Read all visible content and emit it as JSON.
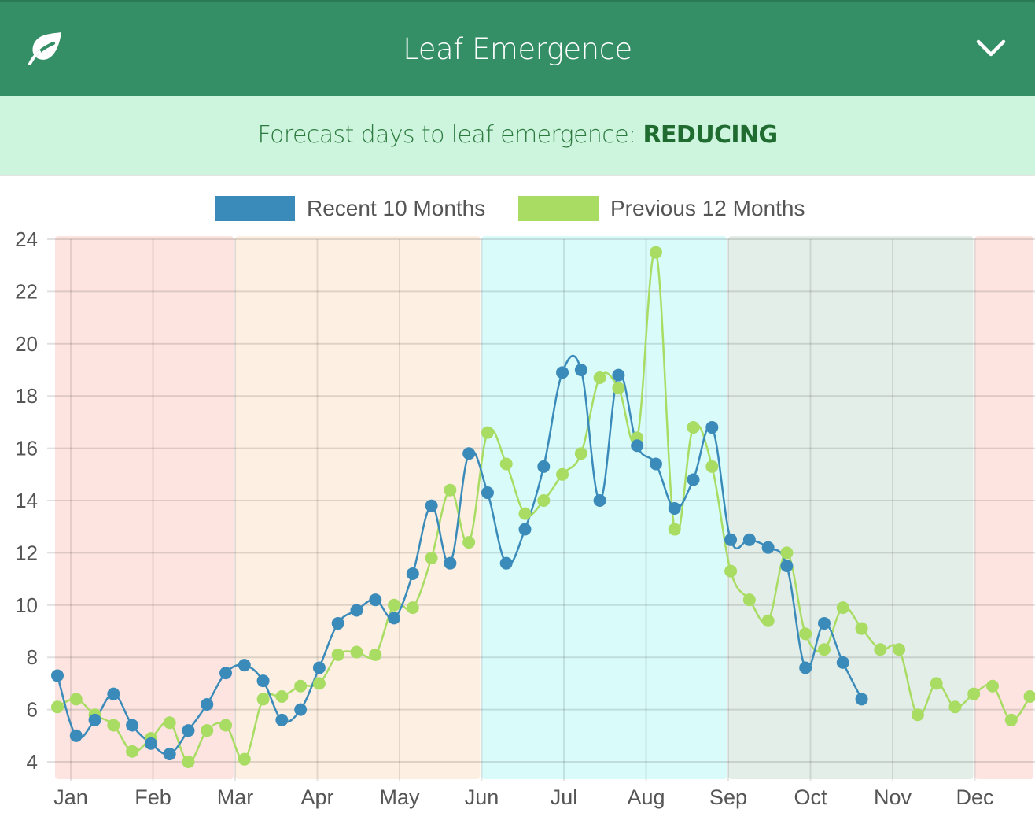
{
  "header": {
    "title": "Leaf Emergence",
    "left_icon": "leaf-icon",
    "right_icon": "chevron-down-icon",
    "background": "#348f66"
  },
  "banner": {
    "prefix": "Forecast days to leaf emergence: ",
    "status": "REDUCING",
    "background": "#cdf4dc"
  },
  "chart_data": {
    "type": "line",
    "title": "",
    "xlabel": "",
    "ylabel": "",
    "ylim": [
      4,
      24
    ],
    "yticks": [
      4,
      6,
      8,
      10,
      12,
      14,
      16,
      18,
      20,
      22,
      24
    ],
    "xticks": [
      "Jan",
      "Feb",
      "Mar",
      "Apr",
      "May",
      "Jun",
      "Jul",
      "Aug",
      "Sep",
      "Oct",
      "Nov",
      "Dec"
    ],
    "grid": true,
    "legend_position": "top-center",
    "x_unit": "week index (0 = first week of January, ~4.33 weeks per month)",
    "season_bands": [
      {
        "name": "winter",
        "from_month": 0,
        "to_month": 2,
        "color": "#fde4e0"
      },
      {
        "name": "spring",
        "from_month": 2,
        "to_month": 5,
        "color": "#fdf0e2"
      },
      {
        "name": "summer",
        "from_month": 5,
        "to_month": 8,
        "color": "#d9fcfb"
      },
      {
        "name": "autumn",
        "from_month": 8,
        "to_month": 11,
        "color": "#e4eee8"
      },
      {
        "name": "winter",
        "from_month": 11,
        "to_month": 12,
        "color": "#fde4e0"
      }
    ],
    "series": [
      {
        "name": "Recent 10 Months",
        "color": "#3b8bba",
        "values": [
          7.3,
          5.0,
          5.6,
          6.6,
          5.4,
          4.7,
          4.3,
          5.2,
          6.2,
          7.4,
          7.7,
          7.1,
          5.6,
          6.0,
          7.6,
          9.3,
          9.8,
          10.2,
          9.5,
          11.2,
          13.8,
          11.6,
          15.8,
          14.3,
          11.6,
          12.9,
          15.3,
          18.9,
          19.0,
          14.0,
          18.8,
          16.1,
          15.4,
          13.7,
          14.8,
          16.8,
          12.5,
          12.5,
          12.2,
          11.5,
          7.6,
          9.3,
          7.8,
          6.4
        ]
      },
      {
        "name": "Previous 12 Months",
        "color": "#a8dc63",
        "values": [
          6.1,
          6.4,
          5.8,
          5.4,
          4.4,
          4.9,
          5.5,
          4.0,
          5.2,
          5.4,
          4.1,
          6.4,
          6.5,
          6.9,
          7.0,
          8.1,
          8.2,
          8.1,
          10.0,
          9.9,
          11.8,
          14.4,
          12.4,
          16.6,
          15.4,
          13.5,
          14.0,
          15.0,
          15.8,
          18.7,
          18.3,
          16.4,
          23.5,
          12.9,
          16.8,
          15.3,
          11.3,
          10.2,
          9.4,
          12.0,
          8.9,
          8.3,
          9.9,
          9.1,
          8.3,
          8.3,
          5.8,
          7.0,
          6.1,
          6.6,
          6.9,
          5.6,
          6.5
        ]
      }
    ]
  }
}
